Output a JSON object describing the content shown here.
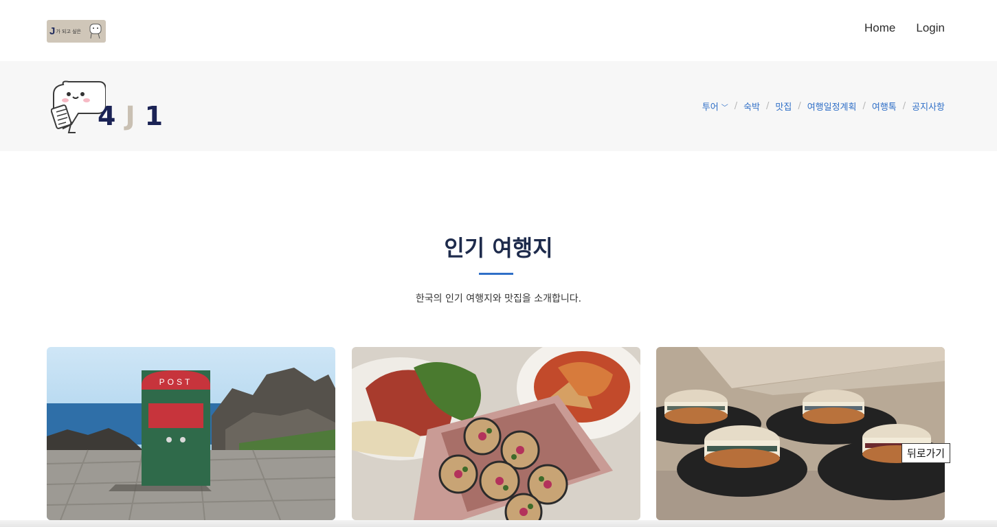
{
  "top_logo": {
    "mark": "J",
    "text": "가 되고 싶은"
  },
  "top_nav": [
    {
      "label": "Home"
    },
    {
      "label": "Login"
    }
  ],
  "brand": {
    "c1": "4",
    "c2": "J",
    "c3": "1"
  },
  "main_nav": {
    "items": [
      {
        "label": "투어"
      },
      {
        "label": "숙박"
      },
      {
        "label": "맛집"
      },
      {
        "label": "여행일정계획"
      },
      {
        "label": "여행톡"
      },
      {
        "label": "공지사항"
      }
    ],
    "separator": "/"
  },
  "section": {
    "title": "인기 여행지",
    "subtitle": "한국의 인기 여행지와 맛집을 소개합니다."
  },
  "cards": {
    "post_label": "POST"
  },
  "back_button": {
    "label": "뒤로가기"
  },
  "colors": {
    "accent": "#2f6fc7",
    "brand_navy": "#1b2355",
    "brand_beige": "#c9c0b3",
    "title": "#1e2b4c"
  },
  "icons": [
    "mascot-icon",
    "chevron-down-icon"
  ]
}
